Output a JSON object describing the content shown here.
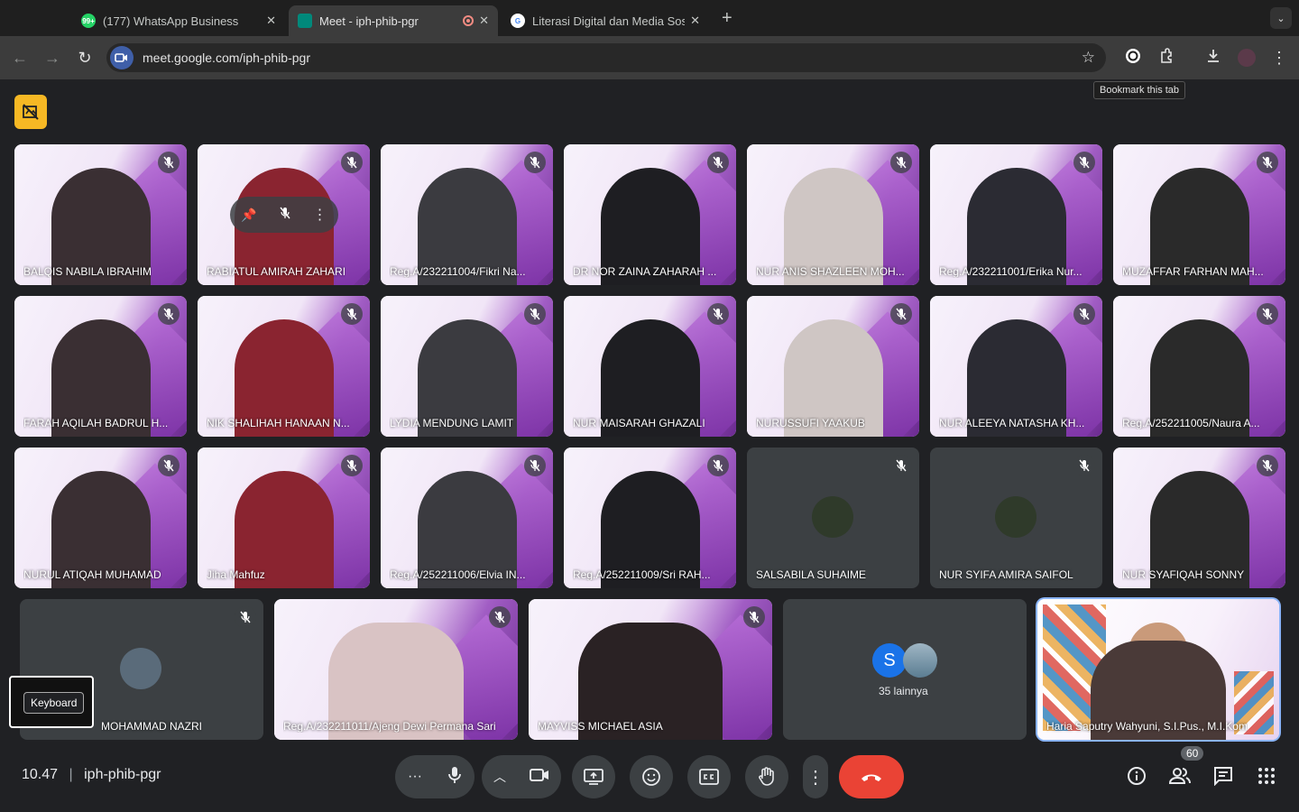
{
  "browser": {
    "tabs": [
      {
        "title": "(177) WhatsApp Business",
        "badge": "99+",
        "icon": "whatsapp-icon",
        "color": "#25d366"
      },
      {
        "title": "Meet - iph-phib-pgr",
        "icon": "meet-icon",
        "color": "#00897b",
        "recording": true
      },
      {
        "title": "Literasi Digital dan Media Sos",
        "icon": "google-icon",
        "color": "#ffffff"
      }
    ],
    "url": "meet.google.com/iph-phib-pgr",
    "tooltip": "Bookmark this tab"
  },
  "participants_grid": [
    {
      "name": "BALQIS NABILA IBRAHIM"
    },
    {
      "name": "RABIATUL AMIRAH ZAHARI"
    },
    {
      "name": "Reg.A/232211004/Fikri Na..."
    },
    {
      "name": "DR NOR ZAINA ZAHARAH ..."
    },
    {
      "name": "NUR ANIS SHAZLEEN MOH..."
    },
    {
      "name": "Reg.A/232211001/Erika Nur..."
    },
    {
      "name": "MUZAFFAR FARHAN MAH..."
    },
    {
      "name": "FARAH AQILAH BADRUL H..."
    },
    {
      "name": "NIK SHALIHAH HANAAN N..."
    },
    {
      "name": "LYDIA MENDUNG LAMIT"
    },
    {
      "name": "NUR MAISARAH GHAZALI"
    },
    {
      "name": "NURUSSUFI YAAKUB"
    },
    {
      "name": "NUR ALEEYA NATASHA KH..."
    },
    {
      "name": "Reg.A/252211005/Naura A..."
    },
    {
      "name": "NURUL ATIQAH MUHAMAD"
    },
    {
      "name": "Jiha Mahfuz"
    },
    {
      "name": "Reg.A/252211006/Elvia IN..."
    },
    {
      "name": "Reg.A/252211009/Sri RAH..."
    },
    {
      "name": "SALSABILA SUHAIME"
    },
    {
      "name": "NUR SYIFA AMIRA SAIFOL"
    },
    {
      "name": "NUR SYAFIQAH SONNY"
    }
  ],
  "participants_bottom": [
    {
      "name": "MOHAMMAD NAZRI"
    },
    {
      "name": "Reg.A/232211011/Ajeng Dewi Permana Sari"
    },
    {
      "name": "MAYVISS MICHAEL ASIA"
    },
    {
      "name": "Haria Saputry Wahyuni, S.I.Pus., M.I.Kom"
    }
  ],
  "more_tile": {
    "initial": "S",
    "label": "35 lainnya"
  },
  "keyboard_label": "Keyboard",
  "meeting": {
    "time": "10.47",
    "code": "iph-phib-pgr"
  },
  "people_count": "60"
}
